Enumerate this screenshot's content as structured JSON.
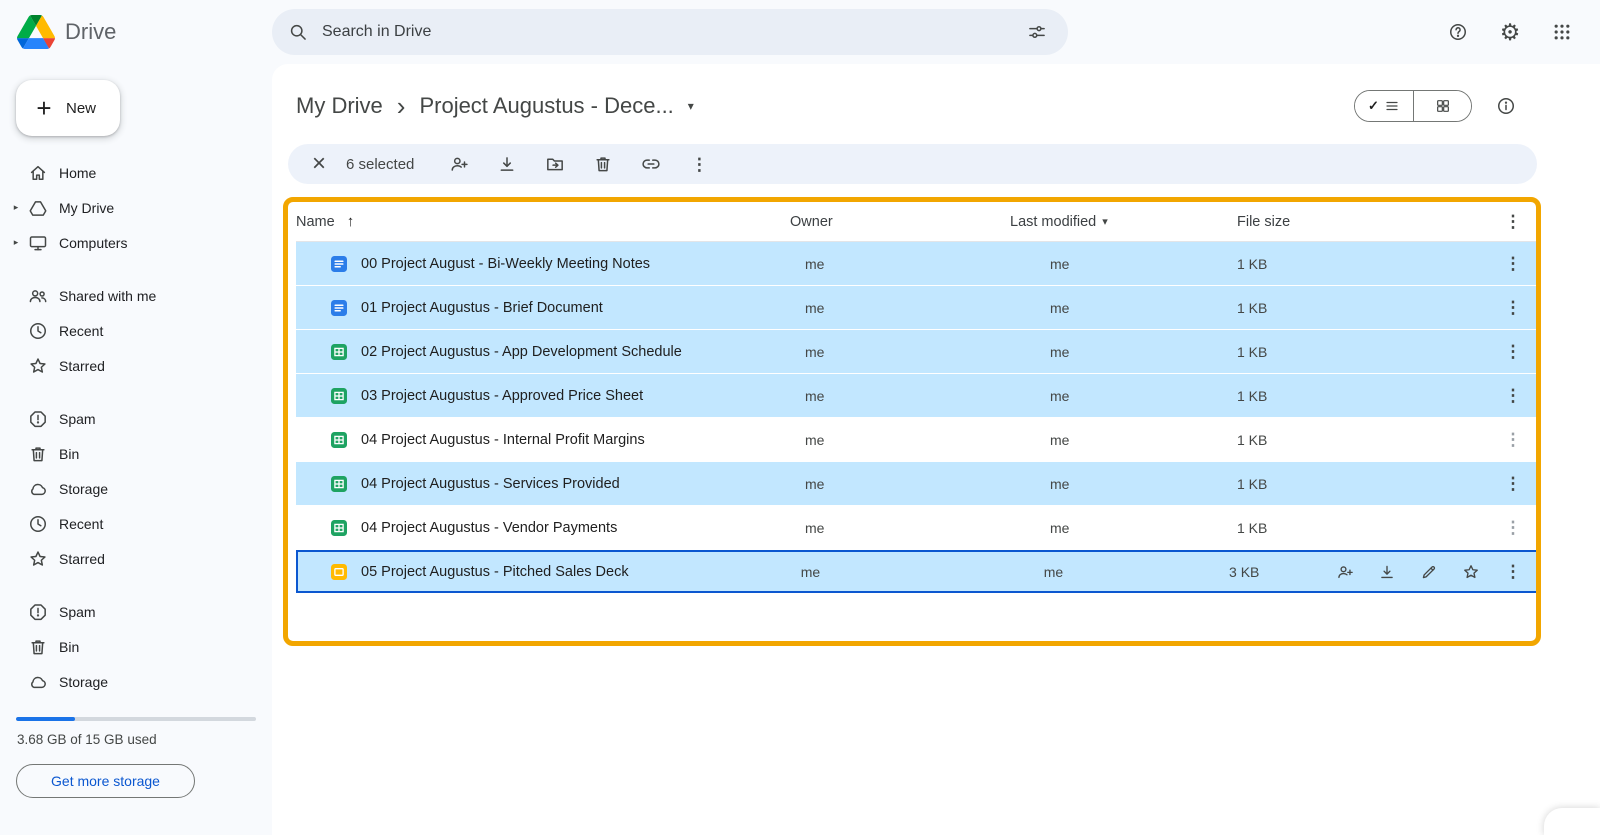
{
  "theme": {
    "accent": "#0b57d0",
    "selection_blue": "#c2e7ff",
    "annotation_orange": "#f2a600",
    "toolbar_bg": "#edf2fa",
    "search_bg": "#e9eef6",
    "storage_used": "#1a73e8",
    "docs_blue": "#2b7de9",
    "sheets_green": "#1ea362",
    "slides_yellow": "#ffba00"
  },
  "header": {
    "app_name": "Drive",
    "search_placeholder": "Search in Drive",
    "actions": [
      {
        "name": "help",
        "icon": "help"
      },
      {
        "name": "settings",
        "icon": "gear"
      },
      {
        "name": "apps",
        "icon": "apps"
      }
    ]
  },
  "sidebar": {
    "new_button_label": "New",
    "groups": [
      {
        "items": [
          {
            "label": "Home",
            "icon": "home"
          },
          {
            "label": "My Drive",
            "icon": "drive",
            "expandable": true
          },
          {
            "label": "Computers",
            "icon": "computers",
            "expandable": true
          }
        ]
      },
      {
        "items": [
          {
            "label": "Shared with me",
            "icon": "people"
          },
          {
            "label": "Recent",
            "icon": "clock"
          },
          {
            "label": "Starred",
            "icon": "star"
          }
        ]
      },
      {
        "items": [
          {
            "label": "Spam",
            "icon": "report"
          },
          {
            "label": "Bin",
            "icon": "trash"
          },
          {
            "label": "Storage",
            "icon": "cloud"
          },
          {
            "label": "Recent",
            "icon": "clock"
          },
          {
            "label": "Starred",
            "icon": "star"
          }
        ]
      },
      {
        "items": [
          {
            "label": "Spam",
            "icon": "report"
          },
          {
            "label": "Bin",
            "icon": "trash"
          },
          {
            "label": "Storage",
            "icon": "cloud"
          }
        ]
      }
    ],
    "storage": {
      "used_text": "3.68 GB of 15 GB used",
      "percent_used": 24.5,
      "button_label": "Get more storage"
    }
  },
  "main": {
    "breadcrumb": {
      "root": "My Drive",
      "current": "Project Augustus - Dece..."
    },
    "view_toggle": {
      "list_selected": true
    },
    "selection_toolbar": {
      "selected_text": "6 selected",
      "actions": [
        {
          "name": "share",
          "icon": "person-add"
        },
        {
          "name": "download",
          "icon": "download"
        },
        {
          "name": "move",
          "icon": "move"
        },
        {
          "name": "delete",
          "icon": "trash"
        },
        {
          "name": "copy-link",
          "icon": "link"
        },
        {
          "name": "more-options",
          "icon": "more"
        }
      ]
    },
    "table": {
      "columns": [
        "Name",
        "Owner",
        "Last modified",
        "File size"
      ],
      "sort": {
        "column": "Name",
        "direction": "ascending"
      },
      "rows": [
        {
          "name": "00 Project August - Bi-Weekly Meeting Notes",
          "type": "docs",
          "owner": "me",
          "last_modified": "me",
          "size": "1 KB",
          "selected": true
        },
        {
          "name": "01 Project Augustus - Brief Document",
          "type": "docs",
          "owner": "me",
          "last_modified": "me",
          "size": "1 KB",
          "selected": true
        },
        {
          "name": "02 Project Augustus - App Development Schedule",
          "type": "sheets",
          "owner": "me",
          "last_modified": "me",
          "size": "1 KB",
          "selected": true
        },
        {
          "name": "03 Project Augustus - Approved Price Sheet",
          "type": "sheets",
          "owner": "me",
          "last_modified": "me",
          "size": "1 KB",
          "selected": true
        },
        {
          "name": "04 Project Augustus - Internal Profit Margins",
          "type": "sheets",
          "owner": "me",
          "last_modified": "me",
          "size": "1 KB",
          "selected": false
        },
        {
          "name": "04 Project Augustus - Services Provided",
          "type": "sheets",
          "owner": "me",
          "last_modified": "me",
          "size": "1 KB",
          "selected": true
        },
        {
          "name": "04 Project Augustus - Vendor Payments",
          "type": "sheets",
          "owner": "me",
          "last_modified": "me",
          "size": "1 KB",
          "selected": false
        },
        {
          "name": "05 Project Augustus - Pitched Sales Deck",
          "type": "slides",
          "owner": "me",
          "last_modified": "me",
          "size": "3 KB",
          "selected": true,
          "focused": true,
          "row_actions": [
            "person-add",
            "download",
            "pencil",
            "star",
            "more"
          ]
        }
      ]
    }
  }
}
